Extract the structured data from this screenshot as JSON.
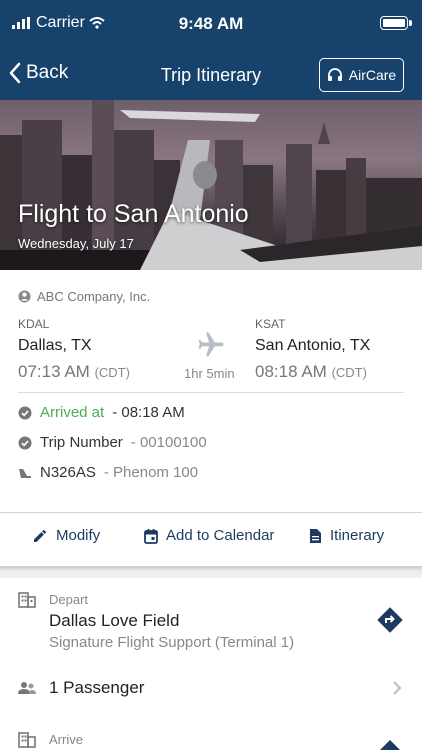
{
  "status": {
    "carrier": "Carrier",
    "time": "9:48 AM"
  },
  "nav": {
    "back_label": "Back",
    "title": "Trip Itinerary",
    "aircare_label": "AirCare"
  },
  "hero": {
    "title": "Flight to San Antonio",
    "date": "Wednesday, July 17"
  },
  "trip": {
    "company": "ABC Company, Inc.",
    "origin": {
      "code": "KDAL",
      "city": "Dallas, TX",
      "time": "07:13 AM",
      "tz": "(CDT)"
    },
    "destination": {
      "code": "KSAT",
      "city": "San Antonio, TX",
      "time": "08:18 AM",
      "tz": "(CDT)"
    },
    "duration": "1hr 5min",
    "arrived_label": "Arrived at",
    "arrived_time": "- 08:18 AM",
    "trip_number_label": "Trip Number",
    "trip_number": "- 00100100",
    "tail": "N326AS",
    "aircraft": "- Phenom 100"
  },
  "actions": {
    "modify": "Modify",
    "calendar": "Add to Calendar",
    "itinerary": "Itinerary"
  },
  "depart": {
    "label": "Depart",
    "name": "Dallas Love Field",
    "fbo": "Signature Flight Support (Terminal 1)"
  },
  "passengers": {
    "label": "1 Passenger"
  },
  "arrive": {
    "label": "Arrive"
  },
  "colors": {
    "brand": "#17426b",
    "accent_green": "#4caf50",
    "action_blue": "#1e3a5f"
  }
}
